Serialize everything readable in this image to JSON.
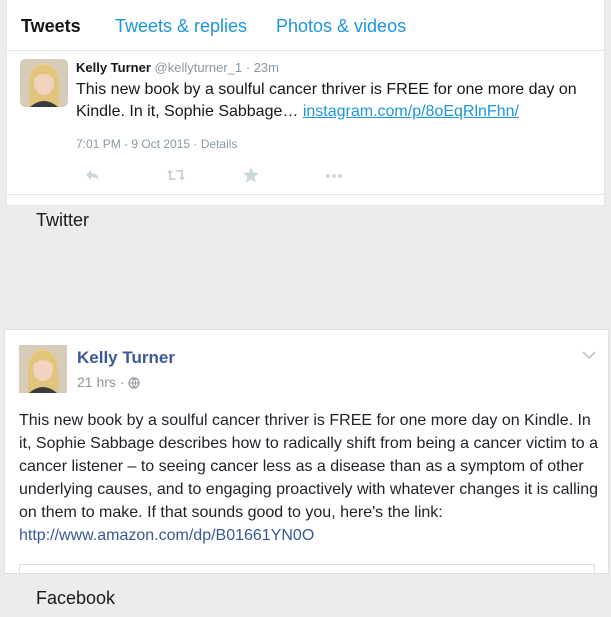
{
  "twitter": {
    "tabs": [
      {
        "label": "Tweets",
        "active": true
      },
      {
        "label": "Tweets & replies",
        "active": false
      },
      {
        "label": "Photos & videos",
        "active": false
      }
    ],
    "tweet": {
      "name": "Kelly Turner",
      "handle": "@kellyturner_1",
      "separator": " · ",
      "age": "23m",
      "text": "This new book by a soulful cancer thriver is FREE for one more day on Kindle. In it, Sophie Sabbage…",
      "link": "instagram.com/p/8oEqRlnFhn/",
      "timestamp": "7:01 PM - 9 Oct 2015",
      "details": "Details"
    },
    "actions": [
      "reply-icon",
      "retweet-icon",
      "favorite-icon",
      "more-icon"
    ],
    "caption": "Twitter"
  },
  "facebook": {
    "post": {
      "name": "Kelly Turner",
      "age": "21 hrs",
      "text": "This new book by a soulful cancer thriver is FREE for one more day on Kindle. In it, Sophie Sabbage describes how to radically shift from being a cancer victim to a cancer listener – to seeing cancer less as a disease than as a symptom of other underlying causes, and to engaging proactively with whatever changes it is calling on them to make. If that sounds good to you, here's the link: ",
      "link": "http://www.amazon.com/dp/B01661YN0O"
    },
    "icons": [
      "globe-icon",
      "chevron-down-icon"
    ],
    "caption": "Facebook"
  },
  "colors": {
    "twitter_blue": "#1b95e0",
    "twitter_gray": "#8899a6",
    "facebook_blue": "#3b5998",
    "background": "#ececec"
  }
}
